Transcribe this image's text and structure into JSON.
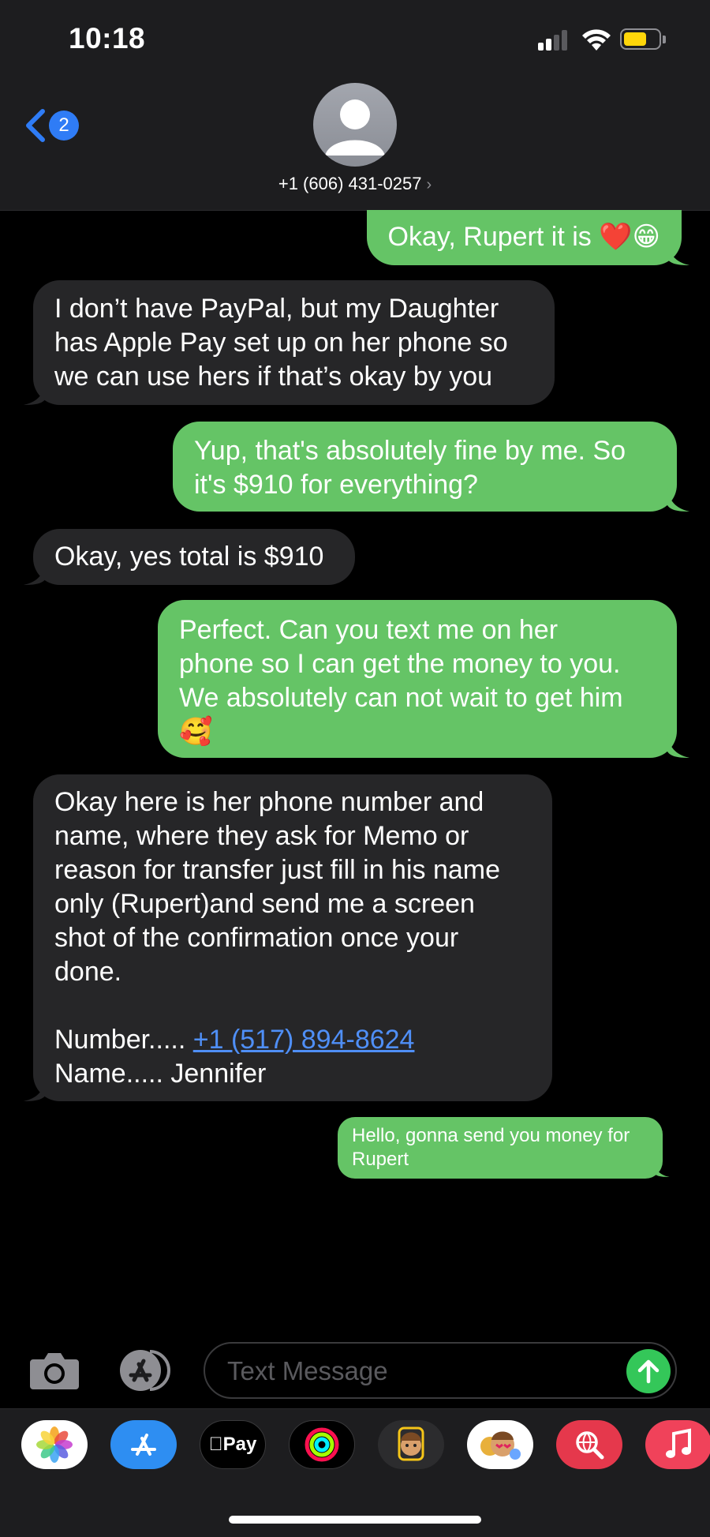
{
  "status": {
    "time": "10:18"
  },
  "header": {
    "back_badge": "2",
    "contact": "+1 (606) 431-0257",
    "chevron": "›"
  },
  "messages": [
    {
      "dir": "out",
      "lines": [
        "Okay, Rupert it is ❤️😁"
      ]
    },
    {
      "dir": "in",
      "lines": [
        "I don’t have PayPal, but my Daughter",
        "has Apple Pay set up on her phone so",
        "we can use hers if that’s okay by you"
      ]
    },
    {
      "dir": "out",
      "lines": [
        "Yup, that's absolutely fine by me. So",
        "it's $910 for everything?"
      ]
    },
    {
      "dir": "in",
      "lines": [
        "Okay, yes total is $910"
      ]
    },
    {
      "dir": "out",
      "lines": [
        "Perfect. Can you text me on her",
        "phone so I can get the money to you.",
        "We absolutely can not wait to get him",
        "🥰"
      ]
    },
    {
      "dir": "in",
      "lines": [
        "Okay here is her phone number and",
        "name, where they ask for Memo or",
        "reason for transfer just fill in his name",
        "only (Rupert)and send me a screen",
        "shot of the confirmation once your",
        "done.",
        "",
        "Number..... ",
        "Name..... Jennifer"
      ],
      "link": "+1 (517) 894-8624"
    },
    {
      "dir": "out",
      "lines": [
        "Hello, gonna send you money for",
        "Rupert"
      ]
    }
  ],
  "input": {
    "placeholder": "Text Message"
  },
  "apps": {
    "apple_pay": "Pay",
    "icons": [
      "photos-icon",
      "app-store-icon",
      "apple-pay-icon",
      "activity-icon",
      "memoji-icon",
      "memoji-stickers-icon",
      "web-search-icon",
      "music-icon"
    ]
  },
  "colors": {
    "outgoing": "#65c466",
    "incoming": "#262628",
    "accent": "#2f7cf6",
    "send": "#34c759"
  }
}
